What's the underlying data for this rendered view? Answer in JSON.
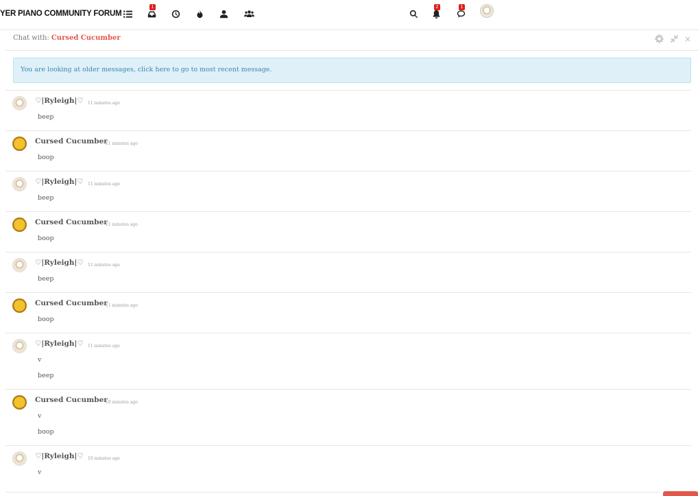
{
  "navbar": {
    "brand": "YER PIANO COMMUNITY FORUM",
    "icons": [
      {
        "name": "categories-icon"
      },
      {
        "name": "unread-icon",
        "badge": "1"
      },
      {
        "name": "recent-icon"
      },
      {
        "name": "popular-icon"
      },
      {
        "name": "user-icon"
      },
      {
        "name": "groups-icon"
      }
    ],
    "right_icons": [
      {
        "name": "search-icon"
      },
      {
        "name": "notifications-icon",
        "badge": "2"
      },
      {
        "name": "chats-icon",
        "badge": "1"
      }
    ]
  },
  "chat": {
    "with_label": "Chat with:",
    "with_user": "Cursed Cucumber",
    "controls": [
      "settings-icon",
      "minimize-icon",
      "close-icon"
    ],
    "alert": "You are looking at older messages, click here to go to most recent message.",
    "messages": [
      {
        "author": "♡|Ryleigh|♡",
        "user": "ryleigh",
        "time": "11 minutes ago",
        "lines": [
          "beep"
        ]
      },
      {
        "author": "Cursed Cucumber",
        "user": "cucumber",
        "time": "11 minutes ago",
        "lines": [
          "boop"
        ]
      },
      {
        "author": "♡|Ryleigh|♡",
        "user": "ryleigh",
        "time": "11 minutes ago",
        "lines": [
          "beep"
        ]
      },
      {
        "author": "Cursed Cucumber",
        "user": "cucumber",
        "time": "11 minutes ago",
        "lines": [
          "boop"
        ]
      },
      {
        "author": "♡|Ryleigh|♡",
        "user": "ryleigh",
        "time": "11 minutes ago",
        "lines": [
          "beep"
        ]
      },
      {
        "author": "Cursed Cucumber",
        "user": "cucumber",
        "time": "11 minutes ago",
        "lines": [
          "boop"
        ]
      },
      {
        "author": "♡|Ryleigh|♡",
        "user": "ryleigh",
        "time": "11 minutes ago",
        "lines": [
          "v",
          "beep"
        ]
      },
      {
        "author": "Cursed Cucumber",
        "user": "cucumber",
        "time": "10 minutes ago",
        "lines": [
          "v",
          "boop"
        ]
      },
      {
        "author": "♡|Ryleigh|♡",
        "user": "ryleigh",
        "time": "10 minutes ago",
        "lines": [
          "v"
        ]
      }
    ]
  },
  "colors": {
    "accent": "#e3564a",
    "badge": "#d9211b",
    "alert_bg": "#dff0f8",
    "alert_text": "#3a87ad"
  }
}
